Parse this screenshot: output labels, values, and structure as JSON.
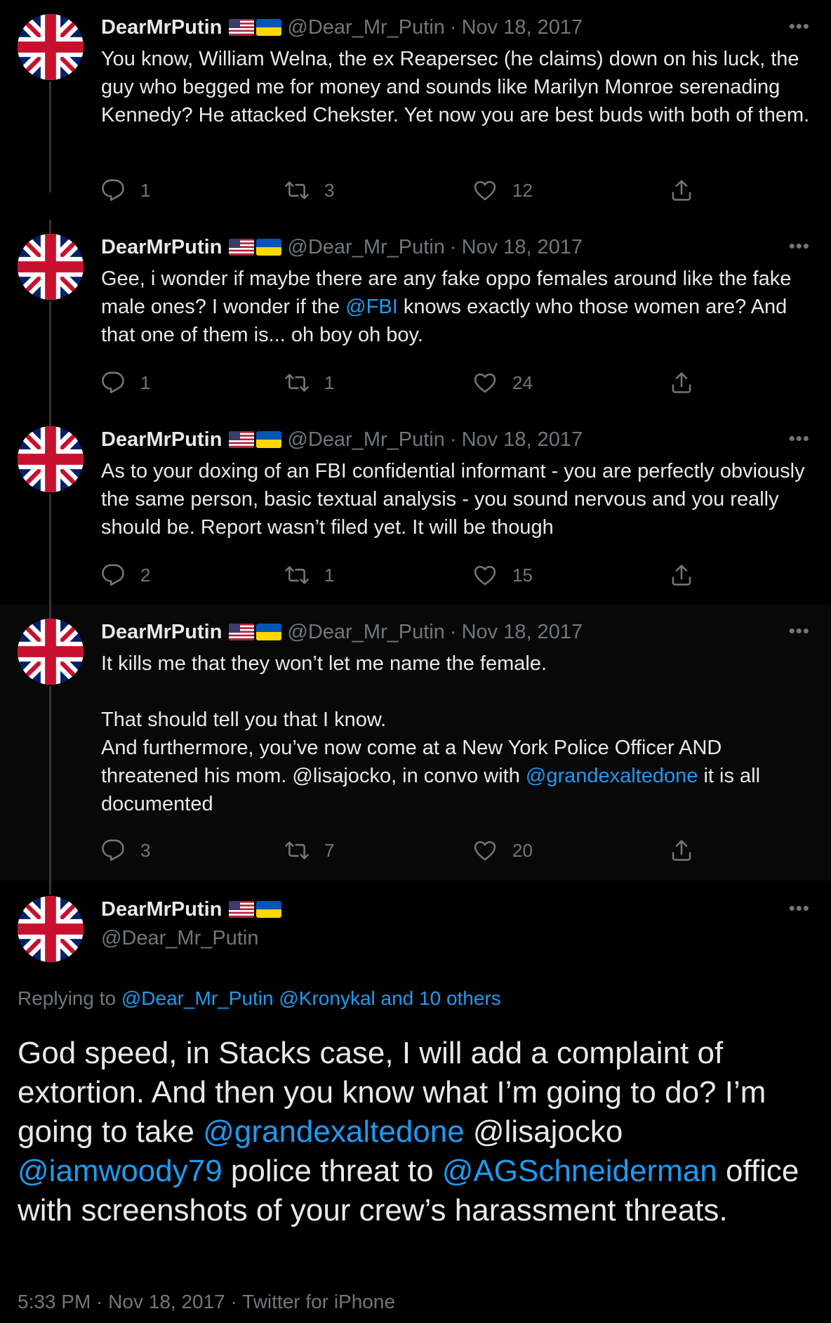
{
  "colors": {
    "background": "#000000",
    "text": "#e7e9ea",
    "secondary": "#71767b",
    "link": "#1d9bf0"
  },
  "thread": [
    {
      "display_name": "DearMrPutin",
      "handle": "@Dear_Mr_Putin",
      "date": "Nov 18, 2017",
      "paragraphs": [
        "You know, William Welna, the ex Reapersec (he claims) down on his luck, the guy who begged me for money and sounds like Marilyn Monroe serenading Kennedy? He attacked Chekster. Yet now you are best buds with both of them."
      ],
      "replies": "1",
      "retweets": "3",
      "likes": "12"
    },
    {
      "display_name": "DearMrPutin",
      "handle": "@Dear_Mr_Putin",
      "date": "Nov 18, 2017",
      "text_a": "Gee, i wonder if maybe there are any fake oppo females around like the fake male ones? I wonder if the ",
      "mention": "@FBI",
      "text_b": " knows exactly who those women are? And that one of them is... oh boy oh boy.",
      "replies": "1",
      "retweets": "1",
      "likes": "24"
    },
    {
      "display_name": "DearMrPutin",
      "handle": "@Dear_Mr_Putin",
      "date": "Nov 18, 2017",
      "paragraphs": [
        "As to your doxing of an FBI confidential informant - you are perfectly obviously the same person, basic textual analysis - you sound nervous and you really should be. Report wasn’t filed yet. It will be though"
      ],
      "replies": "2",
      "retweets": "1",
      "likes": "15"
    },
    {
      "display_name": "DearMrPutin",
      "handle": "@Dear_Mr_Putin",
      "date": "Nov 18, 2017",
      "p1": "It kills me that they won’t let me name the female.",
      "p2": "That should tell you that I know.",
      "p3a": "And furthermore, you’ve now come at a New York Police Officer AND threatened his mom. @lisajocko, in convo with ",
      "p3_mention": "@grandexaltedone",
      "p3b": " it is all documented",
      "replies": "3",
      "retweets": "7",
      "likes": "20"
    }
  ],
  "main": {
    "display_name": "DearMrPutin",
    "handle": "@Dear_Mr_Putin",
    "replying_label": "Replying to ",
    "replying_to": "@Dear_Mr_Putin @Kronykal and 10 others",
    "text_1": "God speed, in Stacks case, I will add a complaint of extortion. And then you know what I’m going to do? I’m going to take ",
    "mention_1": "@grandexaltedone",
    "text_2": " @lisajocko ",
    "mention_2": "@iamwoody79",
    "text_3": " police threat to ",
    "mention_3": "@AGSchneiderman",
    "text_4": " office with screenshots of your crew’s harassment threats.",
    "time": "5:33 PM",
    "date": "Nov 18, 2017",
    "source": "Twitter for iPhone",
    "separator": " · "
  },
  "ui": {
    "separator": "·",
    "more": "•••"
  },
  "icons": {
    "avatar": "union-jack-avatar-icon",
    "flag_us": "us-flag-icon",
    "flag_ua": "ukraine-flag-icon",
    "reply": "reply-icon",
    "retweet": "retweet-icon",
    "like": "heart-icon",
    "share": "share-icon",
    "more": "more-icon"
  }
}
